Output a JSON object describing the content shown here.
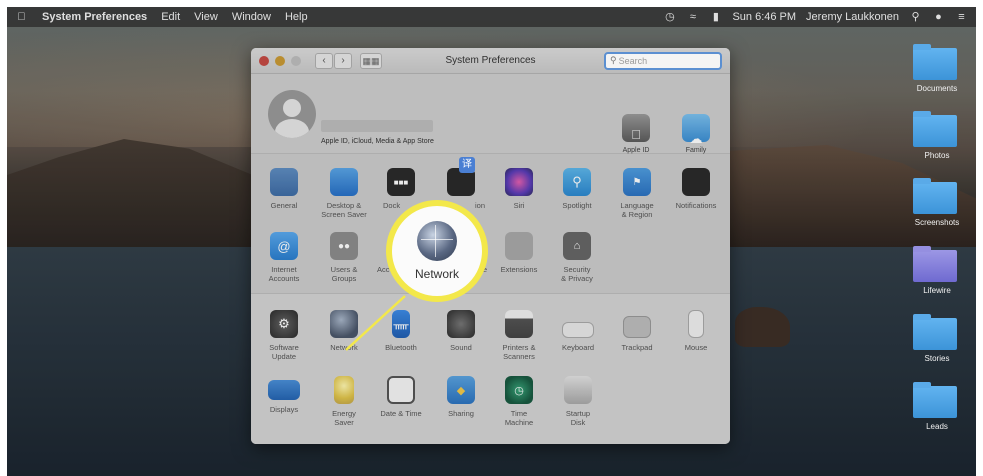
{
  "menubar": {
    "apple_icon": "apple-icon",
    "app_name": "System Preferences",
    "menus": [
      "Edit",
      "View",
      "Window",
      "Help"
    ],
    "clock": "Sun 6:46 PM",
    "user": "Jeremy Laukkonen"
  },
  "window": {
    "title": "System Preferences",
    "search_placeholder": "Search"
  },
  "apple_id": {
    "subtitle": "Apple ID, iCloud, Media & App Store",
    "top_items": [
      {
        "label": "Apple ID"
      },
      {
        "label": "Family\nSharing"
      }
    ]
  },
  "section1": [
    {
      "label": "General",
      "icon": "general-icon"
    },
    {
      "label": "Desktop &\nScreen Saver",
      "icon": "desktop-icon"
    },
    {
      "label": "Dock",
      "icon": "dock-icon"
    },
    {
      "label": "ion",
      "icon": "mission-control-icon"
    },
    {
      "label": "Siri",
      "icon": "siri-icon"
    },
    {
      "label": "Spotlight",
      "icon": "spotlight-icon"
    },
    {
      "label": "Language\n& Region",
      "icon": "language-icon"
    },
    {
      "label": "Notifications",
      "icon": "notifications-icon"
    },
    {
      "label": "Internet\nAccounts",
      "icon": "internet-accounts-icon"
    },
    {
      "label": "Users &\nGroups",
      "icon": "users-icon"
    },
    {
      "label": "Acc",
      "icon": "accessibility-icon"
    },
    {
      "label": "e",
      "icon": "screen-time-icon"
    },
    {
      "label": "Extensions",
      "icon": "extensions-icon"
    },
    {
      "label": "Security\n& Privacy",
      "icon": "security-icon"
    }
  ],
  "section2": [
    {
      "label": "Software\nUpdate",
      "icon": "software-update-icon"
    },
    {
      "label": "Network",
      "icon": "network-icon"
    },
    {
      "label": "Bluetooth",
      "icon": "bluetooth-icon"
    },
    {
      "label": "Sound",
      "icon": "sound-icon"
    },
    {
      "label": "Printers &\nScanners",
      "icon": "printers-icon"
    },
    {
      "label": "Keyboard",
      "icon": "keyboard-icon"
    },
    {
      "label": "Trackpad",
      "icon": "trackpad-icon"
    },
    {
      "label": "Mouse",
      "icon": "mouse-icon"
    },
    {
      "label": "Displays",
      "icon": "displays-icon"
    },
    {
      "label": "Energy\nSaver",
      "icon": "energy-saver-icon"
    },
    {
      "label": "Date & Time",
      "icon": "date-time-icon"
    },
    {
      "label": "Sharing",
      "icon": "sharing-icon"
    },
    {
      "label": "Time\nMachine",
      "icon": "time-machine-icon"
    },
    {
      "label": "Startup\nDisk",
      "icon": "startup-disk-icon"
    }
  ],
  "callout": {
    "label": "Network"
  },
  "desktop_folders": [
    {
      "label": "Documents"
    },
    {
      "label": "Photos"
    },
    {
      "label": "Screenshots"
    },
    {
      "label": "Lifewire"
    },
    {
      "label": "Stories"
    },
    {
      "label": "Leads"
    }
  ],
  "colors": {
    "highlight": "#f3e84a",
    "search_focus": "#5b8fd1"
  }
}
